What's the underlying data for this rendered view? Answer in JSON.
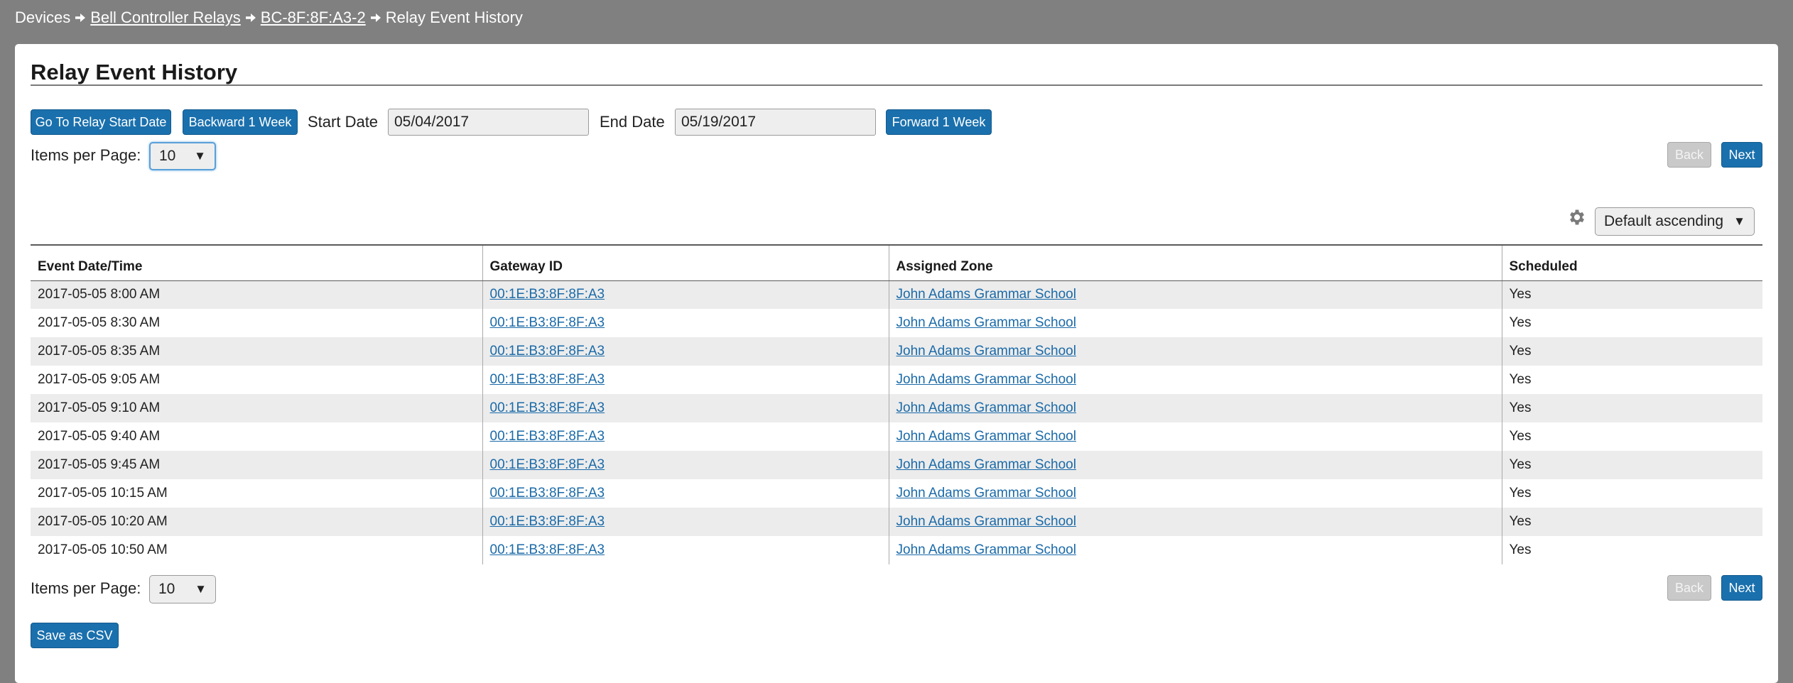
{
  "breadcrumb": {
    "root": "Devices",
    "parent": "Bell Controller Relays",
    "device": "BC-8F:8F:A3-2",
    "current": "Relay Event History"
  },
  "page": {
    "title": "Relay Event History"
  },
  "toolbar": {
    "go_to_start_label": "Go To Relay Start Date",
    "backward_label": "Backward 1 Week",
    "start_date_label": "Start Date",
    "start_date_value": "05/04/2017",
    "end_date_label": "End Date",
    "end_date_value": "05/19/2017",
    "forward_label": "Forward 1 Week"
  },
  "pagination_top": {
    "items_per_page_label": "Items per Page:",
    "items_per_page_value": "10",
    "back_label": "Back",
    "next_label": "Next"
  },
  "sort": {
    "icon": "gear-icon",
    "value": "Default ascending"
  },
  "table": {
    "columns": [
      "Event Date/Time",
      "Gateway ID",
      "Assigned Zone",
      "Scheduled"
    ],
    "rows": [
      {
        "datetime": "2017-05-05 8:00 AM",
        "gateway": "00:1E:B3:8F:8F:A3",
        "zone": "John Adams Grammar School",
        "scheduled": "Yes"
      },
      {
        "datetime": "2017-05-05 8:30 AM",
        "gateway": "00:1E:B3:8F:8F:A3",
        "zone": "John Adams Grammar School",
        "scheduled": "Yes"
      },
      {
        "datetime": "2017-05-05 8:35 AM",
        "gateway": "00:1E:B3:8F:8F:A3",
        "zone": "John Adams Grammar School",
        "scheduled": "Yes"
      },
      {
        "datetime": "2017-05-05 9:05 AM",
        "gateway": "00:1E:B3:8F:8F:A3",
        "zone": "John Adams Grammar School",
        "scheduled": "Yes"
      },
      {
        "datetime": "2017-05-05 9:10 AM",
        "gateway": "00:1E:B3:8F:8F:A3",
        "zone": "John Adams Grammar School",
        "scheduled": "Yes"
      },
      {
        "datetime": "2017-05-05 9:40 AM",
        "gateway": "00:1E:B3:8F:8F:A3",
        "zone": "John Adams Grammar School",
        "scheduled": "Yes"
      },
      {
        "datetime": "2017-05-05 9:45 AM",
        "gateway": "00:1E:B3:8F:8F:A3",
        "zone": "John Adams Grammar School",
        "scheduled": "Yes"
      },
      {
        "datetime": "2017-05-05 10:15 AM",
        "gateway": "00:1E:B3:8F:8F:A3",
        "zone": "John Adams Grammar School",
        "scheduled": "Yes"
      },
      {
        "datetime": "2017-05-05 10:20 AM",
        "gateway": "00:1E:B3:8F:8F:A3",
        "zone": "John Adams Grammar School",
        "scheduled": "Yes"
      },
      {
        "datetime": "2017-05-05 10:50 AM",
        "gateway": "00:1E:B3:8F:8F:A3",
        "zone": "John Adams Grammar School",
        "scheduled": "Yes"
      }
    ]
  },
  "pagination_bottom": {
    "items_per_page_label": "Items per Page:",
    "items_per_page_value": "10",
    "back_label": "Back",
    "next_label": "Next"
  },
  "footer": {
    "save_csv_label": "Save as CSV"
  },
  "colors": {
    "background": "#808080",
    "primary_button": "#1a70ad",
    "disabled_button": "#c9c9c9",
    "link": "#1a6aa8",
    "row_stripe": "#ececec"
  }
}
